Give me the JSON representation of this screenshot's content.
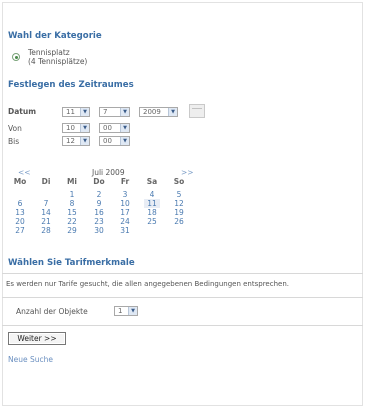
{
  "category": {
    "title": "Wahl der Kategorie",
    "option_name": "Tennisplatz",
    "option_detail": "(4 Tennisplätze)"
  },
  "timeframe": {
    "title": "Festlegen des Zeitraumes",
    "date_label": "Datum",
    "date_day": "11",
    "date_month": "7",
    "date_year": "2009",
    "from_label": "Von",
    "from_hour": "10",
    "from_minute": "00",
    "to_label": "Bis",
    "to_hour": "12",
    "to_minute": "00"
  },
  "calendar": {
    "prev": "<<",
    "next": ">>",
    "month_label": "Juli 2009",
    "weekdays": [
      "Mo",
      "Di",
      "Mi",
      "Do",
      "Fr",
      "Sa",
      "So"
    ],
    "weeks": [
      [
        "",
        "",
        "1",
        "2",
        "3",
        "4",
        "5"
      ],
      [
        "6",
        "7",
        "8",
        "9",
        "10",
        "11",
        "12"
      ],
      [
        "13",
        "14",
        "15",
        "16",
        "17",
        "18",
        "19"
      ],
      [
        "20",
        "21",
        "22",
        "23",
        "24",
        "25",
        "26"
      ],
      [
        "27",
        "28",
        "29",
        "30",
        "31",
        "",
        ""
      ]
    ],
    "selected_day": "11"
  },
  "tariff": {
    "title": "Wählen Sie Tarifmerkmale",
    "info": "Es werden nur Tarife gesucht, die allen angegebenen Bedingungen entsprechen.",
    "objects_label": "Anzahl der Objekte",
    "objects_value": "1"
  },
  "actions": {
    "next_label": "Weiter >>",
    "new_search_label": "Neue Suche"
  },
  "colors": {
    "heading": "#3a6ea5",
    "link": "#6a8fc0",
    "calendar_day": "#4a7ab0"
  },
  "icons": {
    "dropdown": "chevron-down-icon",
    "calendar": "calendar-icon",
    "radio": "radio-selected-icon"
  }
}
